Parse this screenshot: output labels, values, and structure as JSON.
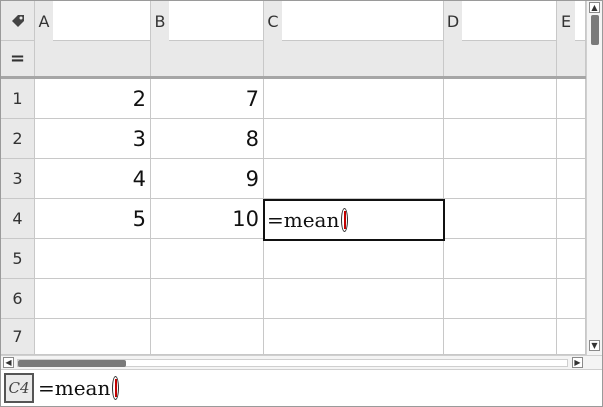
{
  "header": {
    "corner_icon": "tag-icon",
    "columns": [
      "A",
      "B",
      "C",
      "D",
      "E"
    ]
  },
  "formula_row": {
    "label": "="
  },
  "rows": [
    {
      "num": "1",
      "A": "2",
      "B": "7",
      "C": "",
      "D": ""
    },
    {
      "num": "2",
      "A": "3",
      "B": "8",
      "C": "",
      "D": ""
    },
    {
      "num": "3",
      "A": "4",
      "B": "9",
      "C": "",
      "D": ""
    },
    {
      "num": "4",
      "A": "5",
      "B": "10",
      "C": "=mean",
      "D": ""
    },
    {
      "num": "5",
      "A": "",
      "B": "",
      "C": "",
      "D": ""
    },
    {
      "num": "6",
      "A": "",
      "B": "",
      "C": "",
      "D": ""
    },
    {
      "num": "7",
      "A": "",
      "B": "",
      "C": "",
      "D": ""
    }
  ],
  "entry_line": {
    "cell_ref": "C4",
    "text": "=mean"
  },
  "scroll": {
    "horizontal_position": 0.0,
    "vertical_position": 0.0
  },
  "colors": {
    "header_bg": "#e9e9e9",
    "grid_line": "#c8c8c8",
    "cursor_red": "#c00000"
  }
}
